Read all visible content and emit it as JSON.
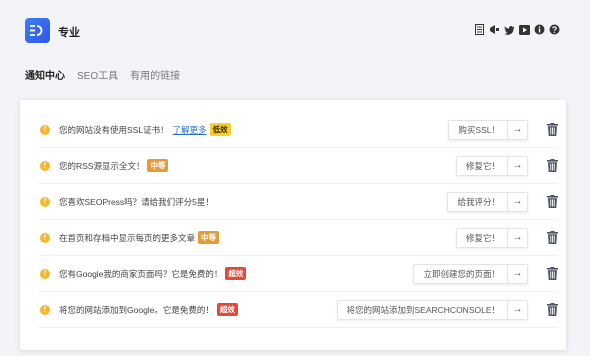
{
  "app": {
    "logo_text": "☰",
    "name": "专业"
  },
  "top_icons": [
    "document-icon",
    "megaphone-icon",
    "twitter-icon",
    "youtube-icon",
    "info-icon",
    "help-icon"
  ],
  "tabs": [
    {
      "label": "通知中心",
      "active": true
    },
    {
      "label": "SEO工具",
      "active": false
    },
    {
      "label": "有用的链接",
      "active": false
    }
  ],
  "notifications": [
    {
      "message": "您的网站没有使用SSL证书！",
      "link": "了解更多",
      "badge": "低效",
      "severity": "low",
      "action": "购买SSL！"
    },
    {
      "message": "您的RSS源显示全文！",
      "link": "",
      "badge": "中等",
      "severity": "mid",
      "action": "修复它！"
    },
    {
      "message": "您喜欢SEOPress吗？请给我们评分5星！",
      "link": "",
      "badge": "",
      "severity": "",
      "action": "给我评分！"
    },
    {
      "message": "在首页和存档中显示每页的更多文章",
      "link": "",
      "badge": "中等",
      "severity": "mid",
      "action": "修复它！"
    },
    {
      "message": "您有Google我的商家页面吗？它是免费的！",
      "link": "",
      "badge": "超效",
      "severity": "high",
      "action": "立即创建您的页面！"
    },
    {
      "message": "将您的网站添加到Google。它是免费的！",
      "link": "",
      "badge": "超效",
      "severity": "high",
      "action": "将您的网站添加到SEARCHCONSOLE！"
    }
  ],
  "colors": {
    "accent": "#2f6ae8",
    "warning": "#f5b730",
    "badge_low": "#f7d02c",
    "badge_mid": "#e39c3a",
    "badge_high": "#e04b3c"
  }
}
